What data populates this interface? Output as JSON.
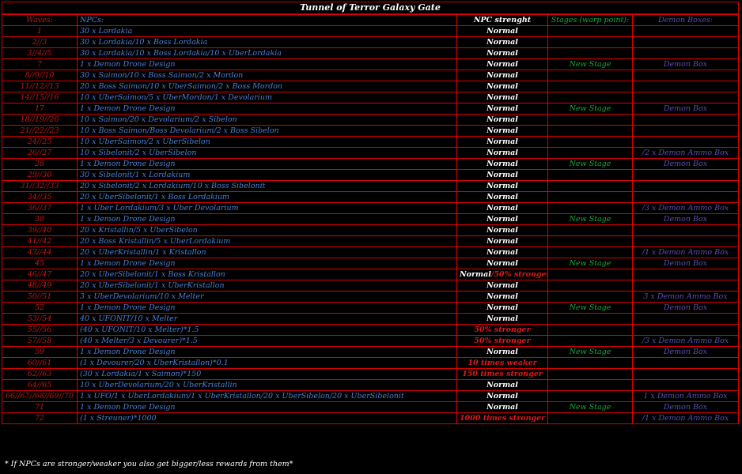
{
  "title": "Tunnel of Terror Galaxy Gate",
  "headers": {
    "waves": "Waves:",
    "npcs": "NPCs:",
    "strength": "NPC strenght",
    "stages": "Stages (warp point):",
    "boxes": "Demon Boxes:"
  },
  "rows": [
    {
      "wave": "1",
      "npcs": "30 x Lordakia",
      "strength": "Normal",
      "stage": "",
      "box": ""
    },
    {
      "wave": "2//3",
      "npcs": "30 x Lordakia/10 x Boss Lordakia",
      "strength": "Normal",
      "stage": "",
      "box": ""
    },
    {
      "wave": "3//4//5",
      "npcs": "30 x Lordakia/10 x Boss Lordakia/10 x UberLordakia",
      "strength": "Normal",
      "stage": "",
      "box": ""
    },
    {
      "wave": "7",
      "npcs": "1 x Demon Drone Design",
      "strength": "Normal",
      "stage": "New Stage",
      "box": "Demon Box"
    },
    {
      "wave": "8//9//10",
      "npcs": "30 x Saimon/10 x Boss Saimon/2 x Mordon",
      "strength": "Normal",
      "stage": "",
      "box": ""
    },
    {
      "wave": "11//12//13",
      "npcs": "20 x Boss Saimon/10 x UberSaimon/2 x Boss Mordon",
      "strength": "Normal",
      "stage": "",
      "box": ""
    },
    {
      "wave": "14//15//16",
      "npcs": "10 x UberSaimon/5 x UberMordon/1 x Devolarium",
      "strength": "Normal",
      "stage": "",
      "box": ""
    },
    {
      "wave": "17",
      "npcs": "1 x Demon Drone Design",
      "strength": "Normal",
      "stage": "New Stage",
      "box": "Demon Box"
    },
    {
      "wave": "18//19//20",
      "npcs": "10 x Saimon/20 x Devolarium/2 x Sibelon",
      "strength": "Normal",
      "stage": "",
      "box": ""
    },
    {
      "wave": "21//22//23",
      "npcs": "10 x Boss Saimon/Boss Devolarium/2 x Boss Sibelon",
      "strength": "Normal",
      "stage": "",
      "box": ""
    },
    {
      "wave": "24//25",
      "npcs": "10 x UberSaimon/2 x UberSibelon",
      "strength": "Normal",
      "stage": "",
      "box": ""
    },
    {
      "wave": "26//27",
      "npcs": "10 x Sibelonit/2 x UberSibelon",
      "strength": "Normal",
      "stage": "",
      "box": "/2 x Demon Ammo Box"
    },
    {
      "wave": "28",
      "npcs": "1 x Demon Drone Design",
      "strength": "Normal",
      "stage": "New Stage",
      "box": "Demon Box"
    },
    {
      "wave": "29//30",
      "npcs": "30 x Sibelonit/1 x Lordakium",
      "strength": "Normal",
      "stage": "",
      "box": ""
    },
    {
      "wave": "31//32//33",
      "npcs": "20 x Sibelonit/2 x Lordakium/10 x Boss Sibelonit",
      "strength": "Normal",
      "stage": "",
      "box": ""
    },
    {
      "wave": "34//35",
      "npcs": "20 x UberSibelonit/1 x Boss Lordakium",
      "strength": "Normal",
      "stage": "",
      "box": ""
    },
    {
      "wave": "36//37",
      "npcs": "1 x Uber Lordakium/3 x Uber Devolarium",
      "strength": "Normal",
      "stage": "",
      "box": "/3 x  Demon Ammo Box"
    },
    {
      "wave": "38",
      "npcs": "1 x Demon Drone Design",
      "strength": "Normal",
      "stage": "New Stage",
      "box": "Demon Box"
    },
    {
      "wave": "39//40",
      "npcs": "20 x Kristallin/5 x UberSibelon",
      "strength": "Normal",
      "stage": "",
      "box": ""
    },
    {
      "wave": "41//42",
      "npcs": "20 x Boss Kristallin/5 x UberLordakium",
      "strength": "Normal",
      "stage": "",
      "box": ""
    },
    {
      "wave": "43//44",
      "npcs": "20 x UberKristallin/1 x Kristallon",
      "strength": "Normal",
      "stage": "",
      "box": "/1 x Demon Ammo Box"
    },
    {
      "wave": "45",
      "npcs": "1 x Demon Drone Design",
      "strength": "Normal",
      "stage": "New Stage",
      "box": "Demon Box"
    },
    {
      "wave": "46//47",
      "npcs": "20 x UberSibelonit/1 x Boss Kristallon",
      "strength": "Normal",
      "strength_extra": "/50% stronger",
      "stage": "",
      "box": ""
    },
    {
      "wave": "48//49",
      "npcs": "20 x UberSibelonit/1 x UberKristallon",
      "strength": "Normal",
      "stage": "",
      "box": ""
    },
    {
      "wave": "50//51",
      "npcs": "3 x UberDevolarium/10 x Melter",
      "strength": "Normal",
      "stage": "",
      "box": "3 x Demon Ammo Box"
    },
    {
      "wave": "52",
      "npcs": "1 x Demon Drone Design",
      "strength": "Normal",
      "stage": "New Stage",
      "box": "Demon Box"
    },
    {
      "wave": "53//54",
      "npcs": "40 x UFONIT/10 x Melter",
      "strength": "Normal",
      "stage": "",
      "box": ""
    },
    {
      "wave": "55//56",
      "npcs": "(40 x UFONIT/10 x Melter)*1.5",
      "strength": "50% stronger",
      "red": true,
      "stage": "",
      "box": ""
    },
    {
      "wave": "57//58",
      "npcs": "(40 x Melter/3 x Devourer)*1.5",
      "strength": "50% stronger",
      "red": true,
      "stage": "",
      "box": "/3 x Demon Ammo Box"
    },
    {
      "wave": "59",
      "npcs": "1 x Demon Drone Design",
      "strength": "Normal",
      "stage": "New Stage",
      "box": "Demon Box"
    },
    {
      "wave": "60//61",
      "npcs": "(1 x Devourer/20 x UberKristallon)*0.1",
      "strength": "10 times weaker",
      "red": true,
      "stage": "",
      "box": ""
    },
    {
      "wave": "62//63",
      "npcs": "(30 x Lordakia/1 x Saimon)*150",
      "strength": "150 times stronger",
      "red": true,
      "stage": "",
      "box": ""
    },
    {
      "wave": "64//65",
      "npcs": "10 x UberDevolarium/20 x UberKristallin",
      "strength": "Normal",
      "stage": "",
      "box": ""
    },
    {
      "wave": "66//67//68//69//70",
      "npcs": "1 x UFO/1 x UberLordakium/1 x UberKristallon/20 x UberSibelon/20 x UberSibelonit",
      "strength": "Normal",
      "stage": "",
      "box": "1 x Demon Ammo Box"
    },
    {
      "wave": "71",
      "npcs": "1 x Demon Drone Design",
      "strength": "Normal",
      "stage": "New Stage",
      "box": "Demon Box"
    },
    {
      "wave": "72",
      "npcs": "(1 x Streuner)*1000",
      "strength": "1000 times stronger",
      "red": true,
      "stage": "",
      "box": "/1 x Demon Ammo Box"
    }
  ],
  "footer": "* If NPCs are stronger/weaker you also get bigger/less rewards from them*"
}
